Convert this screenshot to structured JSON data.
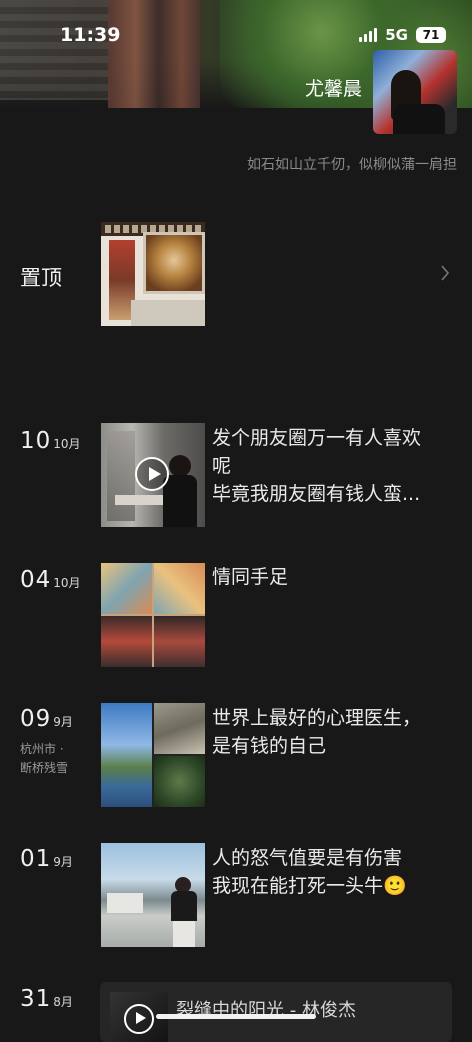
{
  "status_bar": {
    "time": "11:39",
    "network": "5G",
    "battery": "71"
  },
  "profile": {
    "name": "尤馨晨",
    "signature": "如石如山立千仞，似柳似蒲一肩担"
  },
  "pinned": {
    "label": "置顶"
  },
  "posts": [
    {
      "day": "10",
      "month": "10月",
      "location": [
        "",
        ""
      ],
      "text": [
        "发个朋友圈万一有人喜欢",
        "呢",
        "毕竟我朋友圈有钱人蛮..."
      ],
      "has_video": true
    },
    {
      "day": "04",
      "month": "10月",
      "location": [
        "",
        ""
      ],
      "text": [
        "情同手足"
      ],
      "has_video": false
    },
    {
      "day": "09",
      "month": "9月",
      "location": [
        "杭州市 ·",
        "断桥残雪"
      ],
      "text": [
        "世界上最好的心理医生，",
        "是有钱的自己"
      ],
      "has_video": false
    },
    {
      "day": "01",
      "month": "9月",
      "location": [
        "",
        ""
      ],
      "text": [
        "人的怒气值要是有伤害",
        "我现在能打死一头牛🙂"
      ],
      "has_video": false
    },
    {
      "day": "31",
      "month": "8月",
      "location": [
        "",
        ""
      ],
      "text": [
        "裂缝中的阳光 - 林俊杰"
      ],
      "has_video": false
    }
  ],
  "icons": {
    "chevron": "chevron-right-icon",
    "play": "play-icon",
    "emoji": "smiling-face"
  }
}
